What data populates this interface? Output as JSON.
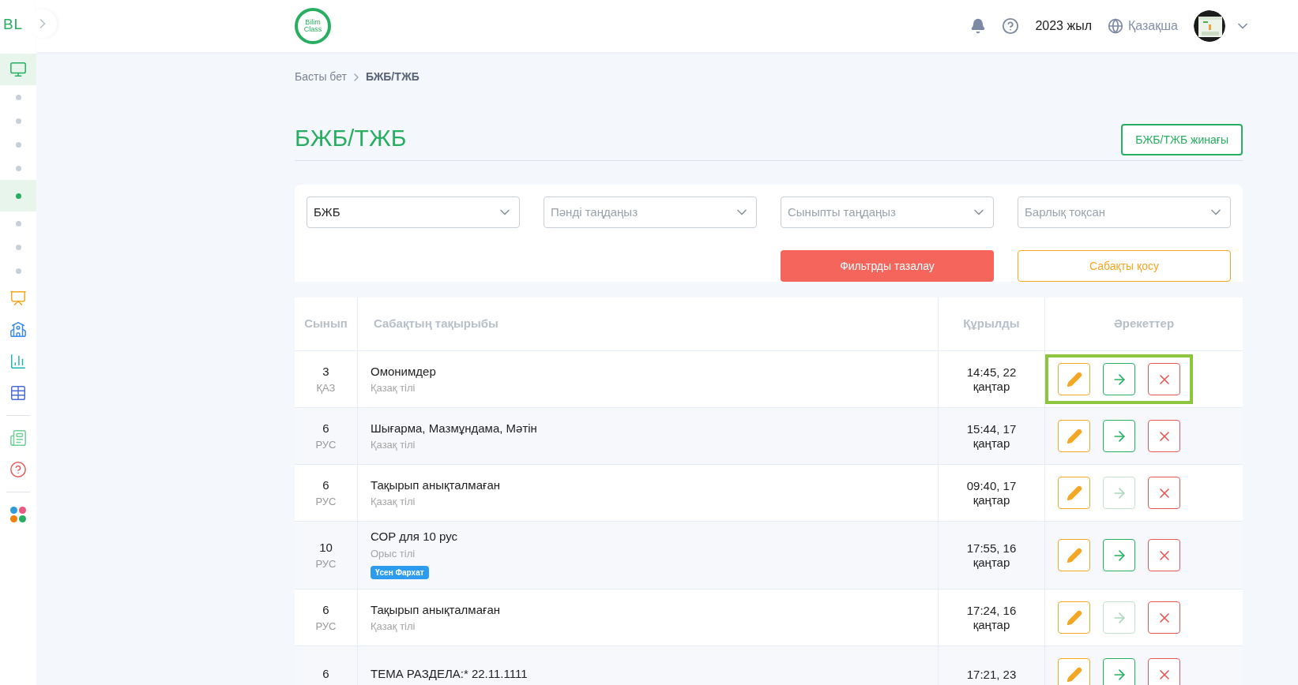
{
  "sidebar": {
    "logo": "BL",
    "items": [
      {
        "kind": "icon",
        "selected": true
      },
      {
        "kind": "dot",
        "selected": false
      },
      {
        "kind": "dot",
        "selected": false
      },
      {
        "kind": "dot",
        "selected": false
      },
      {
        "kind": "dot",
        "selected": false
      },
      {
        "kind": "dot",
        "selected": true
      },
      {
        "kind": "dot",
        "selected": false
      },
      {
        "kind": "dot",
        "selected": false
      },
      {
        "kind": "dot",
        "selected": false
      },
      {
        "kind": "icon",
        "selected": false
      },
      {
        "kind": "icon",
        "selected": false
      },
      {
        "kind": "icon",
        "selected": false
      },
      {
        "kind": "icon",
        "selected": false
      },
      {
        "kind": "divider"
      },
      {
        "kind": "icon",
        "selected": false
      },
      {
        "kind": "icon",
        "selected": false
      },
      {
        "kind": "divider"
      },
      {
        "kind": "icon",
        "selected": false
      }
    ]
  },
  "header": {
    "logo_lines": [
      "Bilim",
      "Class"
    ],
    "year": "2023 жыл",
    "language": "Қазақша"
  },
  "breadcrumb": [
    {
      "label": "Басты бет",
      "current": false
    },
    {
      "label": "БЖБ/ТЖБ",
      "current": true
    }
  ],
  "title": "БЖБ/ТЖБ",
  "collection_button": "БЖБ/ТЖБ жинағы",
  "filters": [
    {
      "value": "БЖБ"
    },
    {
      "placeholder": "Пәнді таңдаңыз"
    },
    {
      "placeholder": "Сыныпты таңдаңыз"
    },
    {
      "placeholder": "Барлық тоқсан"
    }
  ],
  "clear_button": "Фильтрды тазалау",
  "add_button": "Сабақты қосу",
  "table": {
    "columns": [
      "Сынып",
      "Сабақтың тақырыбы",
      "Құрылды",
      "Әрекеттер"
    ],
    "rows": [
      {
        "grade": "3",
        "lang": "ҚАЗ",
        "topic": "Омонимдер",
        "subject": "Қазақ тілі",
        "created": [
          "14:45, 22",
          "қаңтар"
        ],
        "open_enabled": true,
        "highlighted": true
      },
      {
        "grade": "6",
        "lang": "РУС",
        "topic": "Шығарма, Мазмұндама, Мәтін",
        "subject": "Қазақ тілі",
        "created": [
          "15:44, 17",
          "қаңтар"
        ],
        "open_enabled": true,
        "highlighted": false
      },
      {
        "grade": "6",
        "lang": "РУС",
        "topic": "Тақырып анықталмаған",
        "subject": "Қазақ тілі",
        "created": [
          "09:40, 17",
          "қаңтар"
        ],
        "open_enabled": false,
        "highlighted": false
      },
      {
        "grade": "10",
        "lang": "РУС",
        "topic": "СОР для 10 рус",
        "subject": "Орыс тілі",
        "tag": "Үсен Фархат",
        "created": [
          "17:55, 16",
          "қаңтар"
        ],
        "open_enabled": true,
        "highlighted": false
      },
      {
        "grade": "6",
        "lang": "РУС",
        "topic": "Тақырып анықталмаған",
        "subject": "Қазақ тілі",
        "created": [
          "17:24, 16",
          "қаңтар"
        ],
        "open_enabled": false,
        "highlighted": false
      },
      {
        "grade": "6",
        "topic": "ТЕМА РАЗДЕЛА:* 22.11.1111",
        "created": [
          "17:21, 23"
        ],
        "open_enabled": true,
        "highlighted": false
      }
    ]
  }
}
